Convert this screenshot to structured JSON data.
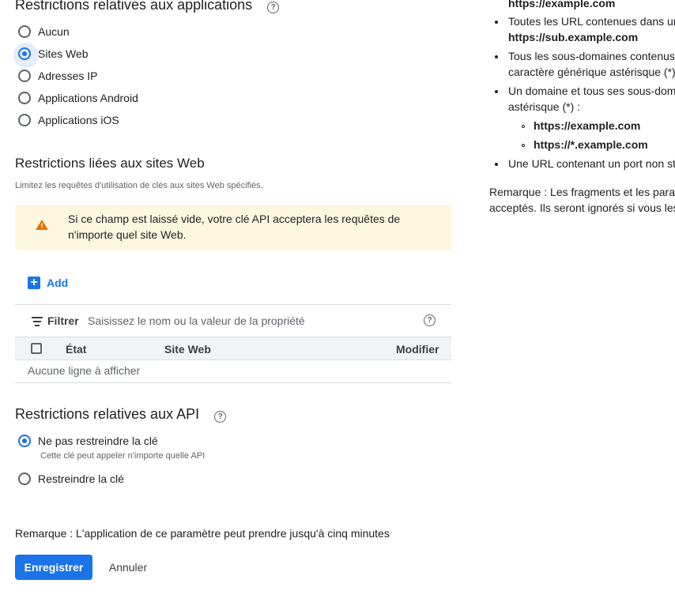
{
  "app_restrictions": {
    "title": "Restrictions relatives aux applications",
    "options": [
      "Aucun",
      "Sites Web",
      "Adresses IP",
      "Applications Android",
      "Applications iOS"
    ],
    "selected": "Sites Web"
  },
  "web_restrictions": {
    "title": "Restrictions liées aux sites Web",
    "subtitle": "Limitez les requêtes d'utilisation de clés aux sites Web spécifiés.",
    "warning": "Si ce champ est laissé vide, votre clé API acceptera les requêtes de n'importe quel site Web.",
    "add_label": "Add",
    "filter_label": "Filtrer",
    "filter_placeholder": "Saisissez le nom ou la valeur de la propriété",
    "columns": [
      "État",
      "Site Web",
      "Modifier"
    ],
    "empty": "Aucune ligne à afficher"
  },
  "api_restrictions": {
    "title": "Restrictions relatives aux API",
    "options": [
      {
        "label": "Ne pas restreindre la clé",
        "sub": "Cette clé peut appeler n'importe quelle API"
      },
      {
        "label": "Restreindre la clé",
        "sub": ""
      }
    ],
    "selected": "Ne pas restreindre la clé"
  },
  "note": "Remarque : L'application de ce paramètre peut prendre jusqu'à cinq minutes",
  "buttons": {
    "save": "Enregistrer",
    "cancel": "Annuler"
  },
  "side_panel": {
    "line0": "https://example.com",
    "b1_text": "Toutes les URL contenues dans un",
    "b1_bold": "https://sub.example.com",
    "b2_text": "Tous les sous-domaines contenus",
    "b2_text2": "caractère générique astérisque (*)",
    "b3_text": "Un domaine et tous ses sous-dom",
    "b3_text2": "astérisque (*) :",
    "sub1": "https://example.com",
    "sub2": "https://*.example.com",
    "b4_text": "Une URL contenant un port non sta",
    "remark1": "Remarque : Les fragments et les parar",
    "remark2": "acceptés. Ils seront ignorés si vous les"
  },
  "colors": {
    "accent": "#1a73e8",
    "warning_bg": "#fef7e0",
    "warning_icon": "#e37400"
  }
}
